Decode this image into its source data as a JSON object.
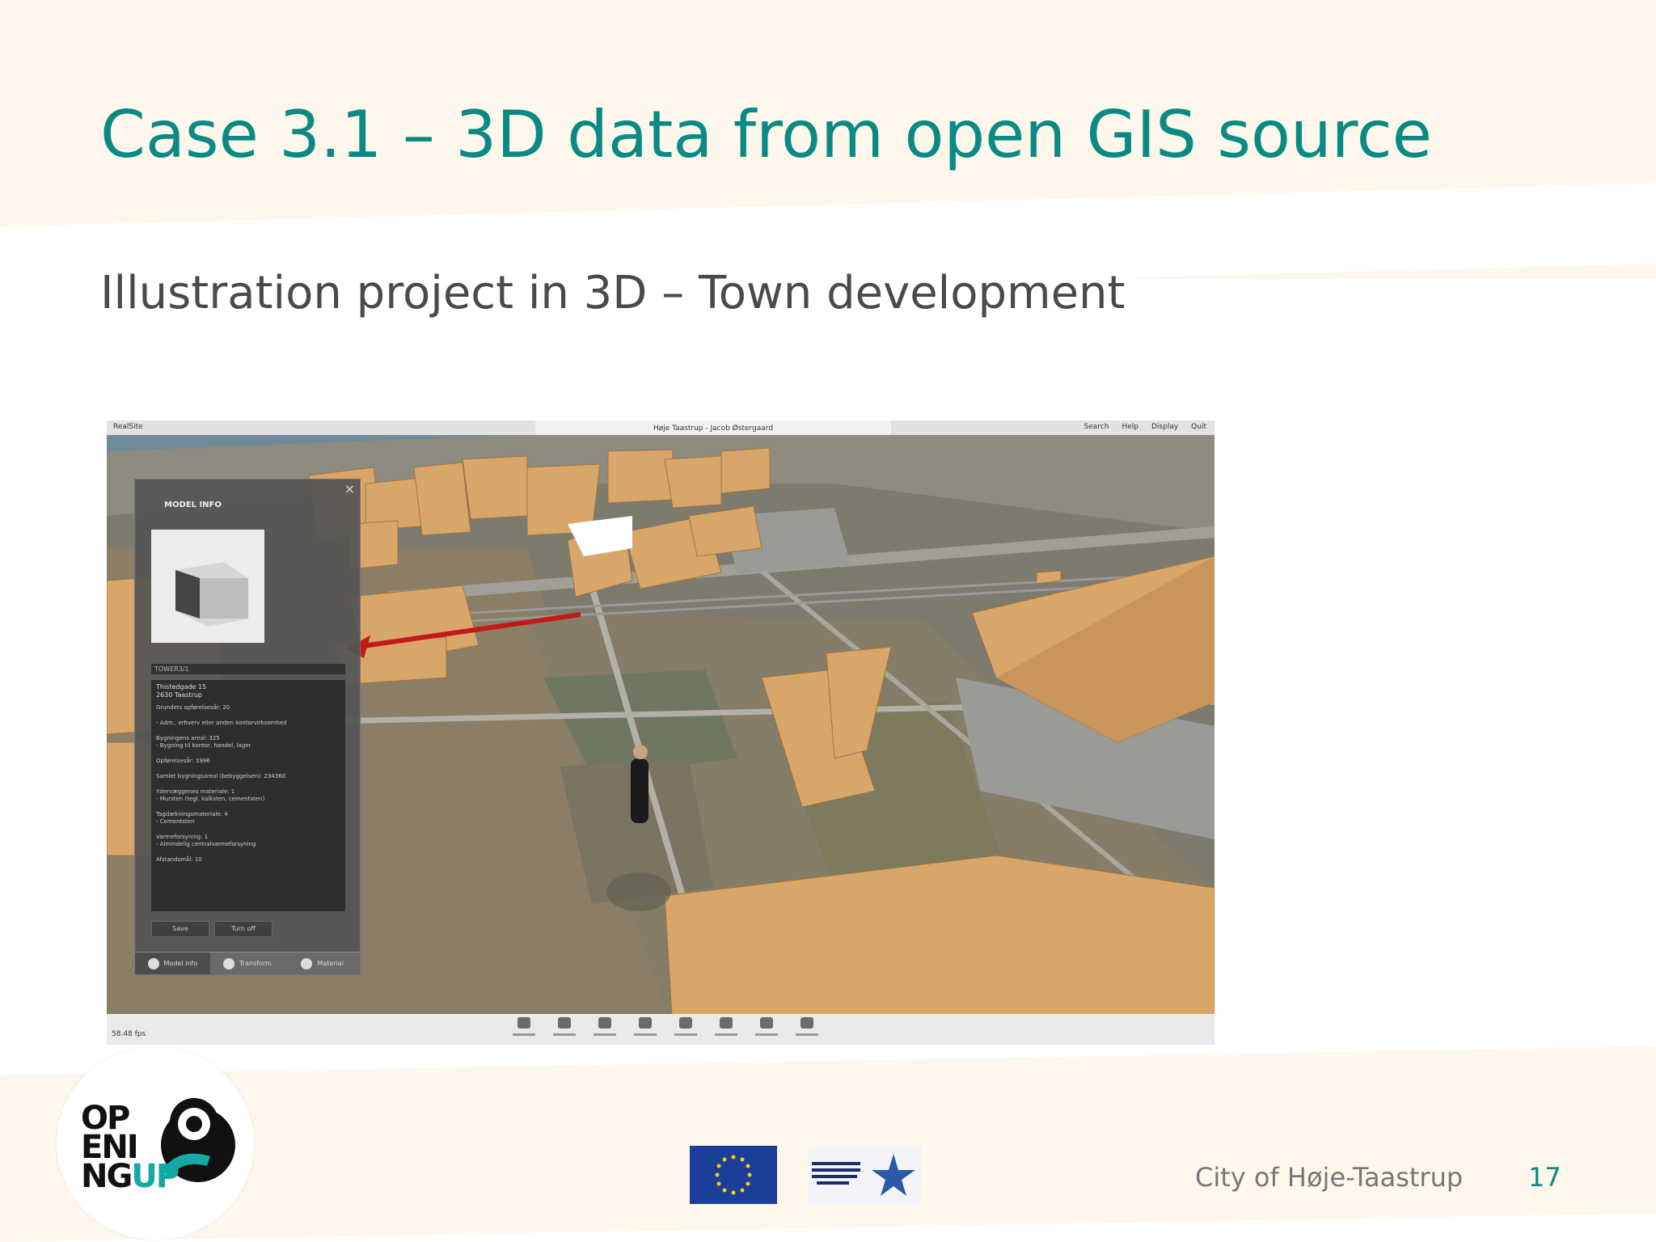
{
  "slide": {
    "title": "Case 3.1 – 3D data from open GIS source",
    "subtitle": "Illustration project in 3D – Town development",
    "footer_city": "City of Høje-Taastrup",
    "page_number": "17"
  },
  "screenshot": {
    "app_name": "RealSite",
    "window_title": "Høje Taastrup - Jacob Østergaard",
    "menu": [
      "Search",
      "Help",
      "Display",
      "Quit"
    ],
    "fps": "58.48 fps",
    "panel": {
      "title": "MODEL INFO",
      "name_bar": "TOWER3/1",
      "address_line1": "Thistedgade 15",
      "address_line2": "2630 Taastrup",
      "info_lines": [
        "Grundets opførelsesår: 20",
        "- Adm., erhverv eller anden kontorvirksomhed",
        "Bygningens areal: 325",
        "- Bygning til kontor, handel, lager",
        "Opførelsesår: 1996",
        "Samlet bygningsareal (bebyggelsen): 234360",
        "Ydervæggenes materiale: 1",
        "- Mursten (tegl, kalksten, cementsten)",
        "Tagdækningsmateriale: 4",
        "- Cementsten",
        "Varmeforsyning: 1",
        "- Almindelig centralvarmeforsyning",
        "Afstandsmål: 10"
      ],
      "buttons": [
        "Save",
        "Turn off"
      ],
      "tabs": [
        "Model info",
        "Transform",
        "Material"
      ]
    },
    "toolbar": [
      "Add model",
      "Navigation",
      "View",
      "Measurement",
      "Analysis",
      "Light",
      "Render",
      "Settings"
    ]
  },
  "colors": {
    "accent": "#0a8a82",
    "building": "#d9a66a",
    "annotation_arrow": "#c21a1a"
  }
}
